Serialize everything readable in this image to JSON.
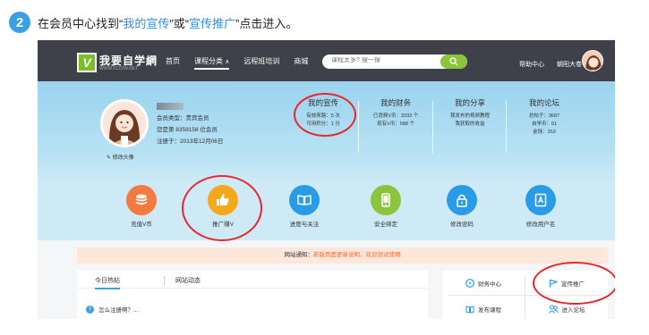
{
  "instruction": {
    "step_number": "2",
    "text_before": "在会员中心找到“",
    "highlight1": "我的宣传",
    "text_middle": "”或“",
    "highlight2": "宣传推广",
    "text_after": "”点击进入。"
  },
  "topnav": {
    "logo_badge": "V",
    "logo_text": "我要自学網",
    "logo_sub": "WWW.51ZXW.NET",
    "items": [
      {
        "label": "首页"
      },
      {
        "label": "课程分类",
        "chevron": "∧"
      },
      {
        "label": "远程班培训"
      },
      {
        "label": "商城"
      }
    ],
    "search_placeholder": "课程太多? 搜一搜",
    "help": "帮助中心",
    "username": "朝阳大卷"
  },
  "profile": {
    "member_type": "会员类型：贵宾会员",
    "member_rank": "您是第 8359158 位会员",
    "register_date": "注册于：2013年12月06日",
    "edit_avatar": "修改头像"
  },
  "stats": [
    {
      "title": "我的宣传",
      "lines": [
        "有效来路：5 次",
        "可用积分：1 分"
      ]
    },
    {
      "title": "我的财务",
      "lines": [
        "已消费V币：3333 个",
        "现有V币：588 个"
      ]
    },
    {
      "title": "我的分享",
      "lines": [
        "我发布的视频教程",
        "我获取的收益"
      ]
    },
    {
      "title": "我的论坛",
      "lines": [
        "总帖子：3687",
        "自学币：61",
        "金钱：353"
      ]
    }
  ],
  "actions": [
    {
      "label": "充值V币",
      "icon": "coin-stack-icon",
      "color": "#f47a3f"
    },
    {
      "label": "推广赚V",
      "icon": "thumbs-up-icon",
      "color": "#f6a81c"
    },
    {
      "label": "进度与关注",
      "icon": "book-icon",
      "color": "#2a9be6"
    },
    {
      "label": "安全绑定",
      "icon": "phone-icon",
      "color": "#8cc43b"
    },
    {
      "label": "修改密码",
      "icon": "lock-icon",
      "color": "#2a9be6"
    },
    {
      "label": "修改用户名",
      "icon": "id-card-icon",
      "color": "#2a9be6"
    }
  ],
  "notice": {
    "prefix": "网站通知：",
    "link": "新版页面更新说明，欢迎测试使用"
  },
  "left_panel": {
    "tabs": [
      "今日热帖",
      "网站动态"
    ],
    "items": [
      "怎么注册啊？..."
    ]
  },
  "right_panel": {
    "cells": [
      {
        "label": "财务中心",
        "icon": "finance-icon"
      },
      {
        "label": "宣传推广",
        "icon": "flag-icon"
      },
      {
        "label": "发布课程",
        "icon": "publish-icon"
      },
      {
        "label": "进入论坛",
        "icon": "forum-icon"
      }
    ]
  },
  "colors": {
    "accent_blue": "#3aa0e6",
    "nav_bg": "#3e4149",
    "annotation_red": "#e8272d",
    "brand_green": "#8cc43b"
  }
}
